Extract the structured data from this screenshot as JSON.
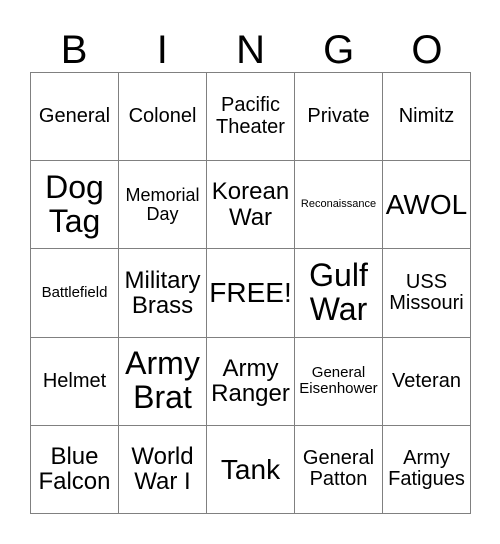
{
  "card": {
    "header": {
      "letters": [
        "B",
        "I",
        "N",
        "G",
        "O"
      ]
    },
    "rows": [
      [
        {
          "text": "General",
          "size": "md"
        },
        {
          "text": "Colonel",
          "size": "md"
        },
        {
          "text": "Pacific\nTheater",
          "size": "md"
        },
        {
          "text": "Private",
          "size": "md"
        },
        {
          "text": "Nimitz",
          "size": "md"
        }
      ],
      [
        {
          "text": "Dog\nTag",
          "size": "xxl"
        },
        {
          "text": "Memorial\nDay",
          "size": "sm"
        },
        {
          "text": "Korean\nWar",
          "size": "lg"
        },
        {
          "text": "Reconaissance",
          "size": "xxs"
        },
        {
          "text": "AWOL",
          "size": "xl"
        }
      ],
      [
        {
          "text": "Battlefield",
          "size": "xs"
        },
        {
          "text": "Military\nBrass",
          "size": "lg"
        },
        {
          "text": "FREE!",
          "size": "xl"
        },
        {
          "text": "Gulf\nWar",
          "size": "xxl"
        },
        {
          "text": "USS\nMissouri",
          "size": "md"
        }
      ],
      [
        {
          "text": "Helmet",
          "size": "md"
        },
        {
          "text": "Army\nBrat",
          "size": "xxl"
        },
        {
          "text": "Army\nRanger",
          "size": "lg"
        },
        {
          "text": "General\nEisenhower",
          "size": "xs"
        },
        {
          "text": "Veteran",
          "size": "md"
        }
      ],
      [
        {
          "text": "Blue\nFalcon",
          "size": "lg"
        },
        {
          "text": "World\nWar I",
          "size": "lg"
        },
        {
          "text": "Tank",
          "size": "xl"
        },
        {
          "text": "General\nPatton",
          "size": "md"
        },
        {
          "text": "Army\nFatigues",
          "size": "md"
        }
      ]
    ],
    "colors": {
      "background": "#ffffff",
      "text": "#000000",
      "grid_line": "#808080"
    }
  }
}
